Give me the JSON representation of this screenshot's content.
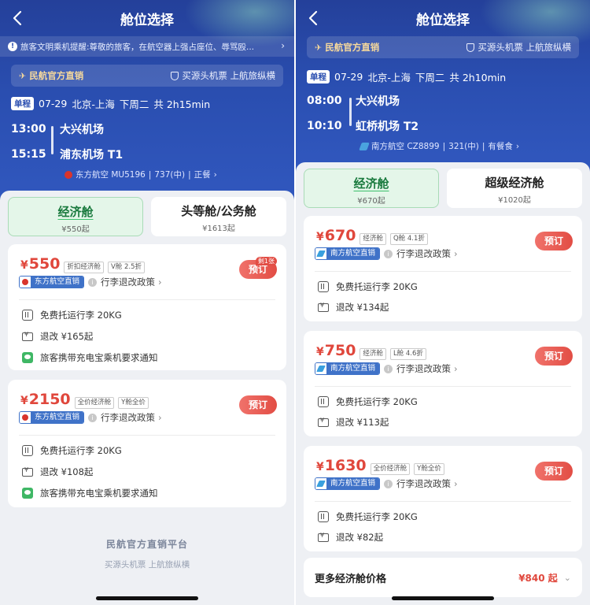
{
  "left": {
    "header": {
      "title": "舱位选择"
    },
    "notice": "旅客文明乘机提醒:尊敬的旅客，在航空器上强占座位、辱骂殴...",
    "official": {
      "brand": "民航官方直销",
      "slogan": "买源头机票 上航旅纵横"
    },
    "route": {
      "badge": "单程",
      "date": "07-29",
      "cities": "北京-上海",
      "weekday": "下周二",
      "duration": "共 2h15min"
    },
    "depart": {
      "time": "13:00",
      "airport": "大兴机场"
    },
    "arrive": {
      "time": "15:15",
      "airport": "浦东机场 T1"
    },
    "flight": {
      "airline": "东方航空 MU5196",
      "aircraft": "737(中)",
      "meal": "正餐"
    },
    "tabs": [
      {
        "name": "经济舱",
        "from": "¥550起"
      },
      {
        "name": "头等舱/公务舱",
        "from": "¥1613起"
      }
    ],
    "fares": [
      {
        "currency": "¥",
        "price": "550",
        "tag1": "折扣经济舱",
        "tag2": "V舱 2.5折",
        "channel": "东方航空直销",
        "policy": "行李退改政策",
        "book": "预订",
        "remain": "剩1张",
        "baggage": "免费托运行李 20KG",
        "refund": "退改 ¥165起",
        "notice": "旅客携带充电宝乘机要求通知"
      },
      {
        "currency": "¥",
        "price": "2150",
        "tag1": "全价经济舱",
        "tag2": "Y舱全价",
        "channel": "东方航空直销",
        "policy": "行李退改政策",
        "book": "预订",
        "baggage": "免费托运行李 20KG",
        "refund": "退改 ¥108起",
        "notice": "旅客携带充电宝乘机要求通知"
      }
    ],
    "footer": {
      "brand": "民航官方直销平台",
      "slogan": "买源头机票 上航旅纵横"
    }
  },
  "right": {
    "header": {
      "title": "舱位选择"
    },
    "official": {
      "brand": "民航官方直销",
      "slogan": "买源头机票 上航旅纵横"
    },
    "route": {
      "badge": "单程",
      "date": "07-29",
      "cities": "北京-上海",
      "weekday": "下周二",
      "duration": "共 2h10min"
    },
    "depart": {
      "time": "08:00",
      "airport": "大兴机场"
    },
    "arrive": {
      "time": "10:10",
      "airport": "虹桥机场 T2"
    },
    "flight": {
      "airline": "南方航空 CZ8899",
      "aircraft": "321(中)",
      "meal": "有餐食"
    },
    "tabs": [
      {
        "name": "经济舱",
        "from": "¥670起"
      },
      {
        "name": "超级经济舱",
        "from": "¥1020起"
      }
    ],
    "fares": [
      {
        "currency": "¥",
        "price": "670",
        "tag1": "经济舱",
        "tag2": "Q舱 4.1折",
        "channel": "南方航空直销",
        "policy": "行李退改政策",
        "book": "预订",
        "baggage": "免费托运行李 20KG",
        "refund": "退改 ¥134起"
      },
      {
        "currency": "¥",
        "price": "750",
        "tag1": "经济舱",
        "tag2": "L舱 4.6折",
        "channel": "南方航空直销",
        "policy": "行李退改政策",
        "book": "预订",
        "baggage": "免费托运行李 20KG",
        "refund": "退改 ¥113起"
      },
      {
        "currency": "¥",
        "price": "1630",
        "tag1": "全价经济舱",
        "tag2": "Y舱全价",
        "channel": "南方航空直销",
        "policy": "行李退改政策",
        "book": "预订",
        "baggage": "免费托运行李 20KG",
        "refund": "退改 ¥82起"
      }
    ],
    "more": {
      "label": "更多经济舱价格",
      "price": "¥840 起"
    }
  },
  "colors": {
    "accent": "#e0473c",
    "brand_blue": "#2a4eb0",
    "active_tab": "#e4f6e9"
  }
}
